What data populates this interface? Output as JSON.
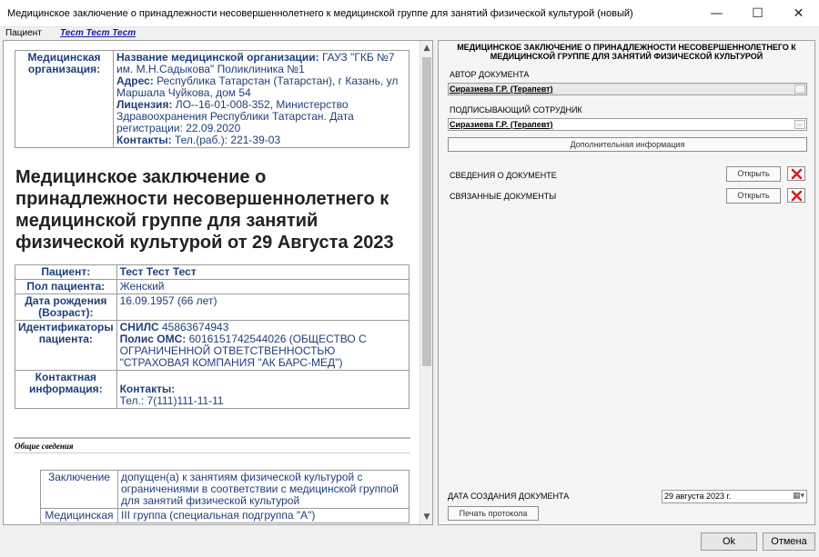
{
  "window": {
    "title": "Медицинское заключение о принадлежности несовершеннолетнего к медицинской группе для занятий физической культурой (новый)",
    "minimize": "—",
    "maximize": "☐",
    "close": "✕"
  },
  "patient": {
    "label": "Пациент",
    "name": "Тест Тест Тест"
  },
  "org": {
    "label": "Медицинская организация:",
    "name_label": "Название медицинской организации:",
    "name": " ГАУЗ \"ГКБ №7 им. М.Н.Садыкова\" Поликлиника №1",
    "address_label": "Адрес:",
    "address": " Республика Татарстан (Татарстан), г Казань, ул Маршала Чуйкова, дом 54",
    "license_label": "Лицензия:",
    "license": " ЛО--16-01-008-352, Министерство Здравоохранения Республики Татарстан. Дата регистрации: 22.09.2020",
    "contacts_label": "Контакты:",
    "contacts": " Тел.(раб.): 221-39-03"
  },
  "doc_title": "Медицинское заключение о принадлежности несовершеннолетнего к медицинской группе для занятий физической культурой от 29 Августа 2023",
  "patient_table": {
    "patient_label": "Пациент:",
    "patient_value": "Тест Тест Тест",
    "sex_label": "Пол пациента:",
    "sex_value": "Женский",
    "dob_label": "Дата рождения (Возраст):",
    "dob_value": "16.09.1957 (66 лет)",
    "ids_label": "Идентификаторы пациента:",
    "snils_label": "СНИЛС",
    "snils_value": " 45863674943",
    "oms_label": "Полис ОМС:",
    "oms_value": " 6016151742544026 (ОБЩЕСТВО С ОГРАНИЧЕННОЙ ОТВЕТСТВЕННОСТЬЮ \"СТРАХОВАЯ КОМПАНИЯ \"АК БАРС-МЕД\")",
    "contact_label": "Контактная информация:",
    "contacts_label": "Контакты:",
    "contacts_value": "Тел.: 7(111)111-11-11"
  },
  "general": {
    "section_title": "Общие сведения",
    "conclusion_label": "Заключение",
    "conclusion_value": "допущен(а) к занятиям физической культурой с ограничениями в соответствии с медицинской группой для занятий физической культурой",
    "group_label": "Медицинская",
    "group_value": "III группа (специальная подгруппа \"А\")"
  },
  "right": {
    "title": "МЕДИЦИНСКОЕ ЗАКЛЮЧЕНИЕ О ПРИНАДЛЕЖНОСТИ НЕСОВЕРШЕННОЛЕТНЕГО К МЕДИЦИНСКОЙ ГРУППЕ ДЛЯ ЗАНЯТИЙ ФИЗИЧЕСКОЙ КУЛЬТУРОЙ",
    "author_label": "АВТОР ДОКУМЕНТА",
    "author_value": "Сиразиева Г.Р. (Терапевт)",
    "signer_label": "ПОДПИСЫВАЮЩИЙ СОТРУДНИК",
    "signer_value": "Сиразиева Г.Р. (Терапевт)",
    "dots": "...",
    "extra_info": "Дополнительная информация",
    "doc_info_label": "СВЕДЕНИЯ О ДОКУМЕНТЕ",
    "related_label": "СВЯЗАННЫЕ ДОКУМЕНТЫ",
    "open": "Открыть",
    "created_label": "ДАТА СОЗДАНИЯ ДОКУМЕНТА",
    "created_value": "29  августа  2023 г.",
    "print": "Печать протокола"
  },
  "footer": {
    "ok": "Ok",
    "cancel": "Отмена"
  },
  "icons": {
    "delete": "red-x-icon",
    "calendar": "calendar-dropdown-icon"
  },
  "colors": {
    "doc_text": "#1f3f7a",
    "delete_red": "#d42020",
    "patient_link": "#1b1ba8"
  }
}
